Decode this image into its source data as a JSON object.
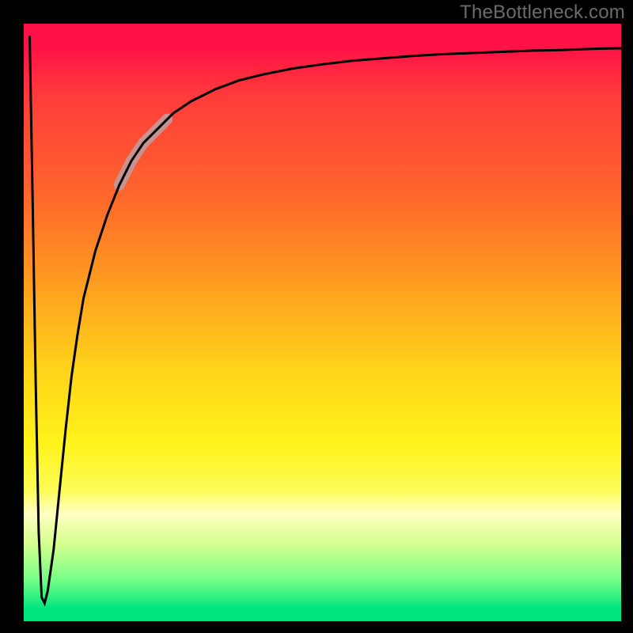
{
  "watermark": "TheBottleneck.com",
  "chart_data": {
    "type": "line",
    "title": "",
    "xlabel": "",
    "ylabel": "",
    "xlim": [
      0,
      100
    ],
    "ylim": [
      0,
      100
    ],
    "background_gradient_stops": [
      {
        "pos": 0.0,
        "color": "#ff1246"
      },
      {
        "pos": 0.3,
        "color": "#ff6a2a"
      },
      {
        "pos": 0.58,
        "color": "#ffd419"
      },
      {
        "pos": 0.78,
        "color": "#fcfc55"
      },
      {
        "pos": 0.93,
        "color": "#76ff87"
      },
      {
        "pos": 1.0,
        "color": "#00e57d"
      }
    ],
    "series": [
      {
        "name": "bottleneck-curve",
        "color": "#000000",
        "x": [
          1.0,
          1.5,
          2.0,
          2.5,
          3.0,
          3.5,
          4.0,
          5.0,
          6.0,
          7.0,
          8.0,
          9.0,
          10,
          12,
          14,
          16,
          18,
          20,
          22,
          25,
          28,
          32,
          36,
          40,
          45,
          50,
          55,
          60,
          65,
          70,
          75,
          80,
          85,
          90,
          95,
          100
        ],
        "values": [
          98,
          70,
          40,
          15,
          4,
          3,
          5,
          12,
          22,
          32,
          41,
          48,
          54,
          62,
          68,
          73,
          77,
          80,
          82,
          85,
          87,
          89,
          90.5,
          91.5,
          92.5,
          93.2,
          93.8,
          94.2,
          94.6,
          94.9,
          95.1,
          95.3,
          95.5,
          95.6,
          95.8,
          95.9
        ]
      }
    ],
    "highlight_segment": {
      "x_start": 16,
      "x_end": 24,
      "color": "#c7928f",
      "width": 14
    }
  }
}
